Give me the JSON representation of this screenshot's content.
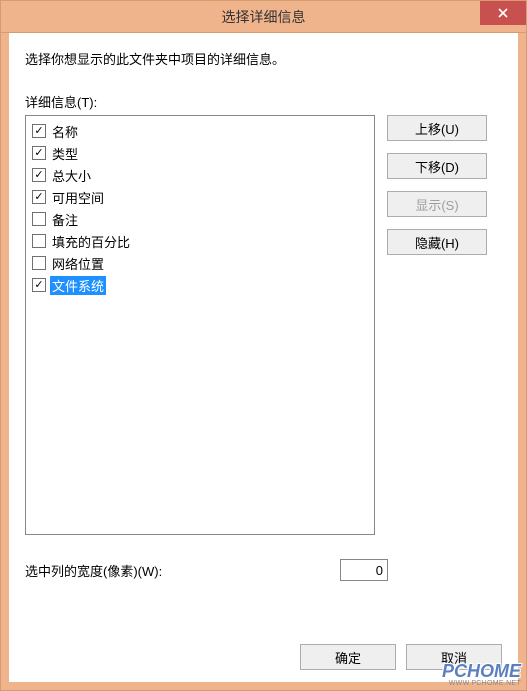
{
  "title": "选择详细信息",
  "instruction": "选择你想显示的此文件夹中项目的详细信息。",
  "list_label": "详细信息(T):",
  "items": [
    {
      "label": "名称",
      "checked": true,
      "selected": false
    },
    {
      "label": "类型",
      "checked": true,
      "selected": false
    },
    {
      "label": "总大小",
      "checked": true,
      "selected": false
    },
    {
      "label": "可用空间",
      "checked": true,
      "selected": false
    },
    {
      "label": "备注",
      "checked": false,
      "selected": false
    },
    {
      "label": "填充的百分比",
      "checked": false,
      "selected": false
    },
    {
      "label": "网络位置",
      "checked": false,
      "selected": false
    },
    {
      "label": "文件系统",
      "checked": true,
      "selected": true
    }
  ],
  "buttons": {
    "move_up": "上移(U)",
    "move_down": "下移(D)",
    "show": "显示(S)",
    "hide": "隐藏(H)",
    "ok": "确定",
    "cancel": "取消"
  },
  "width_label": "选中列的宽度(像素)(W):",
  "width_value": "0",
  "watermark": {
    "main": "PCHOME",
    "sub": "WWW.PCHOME.NET"
  }
}
